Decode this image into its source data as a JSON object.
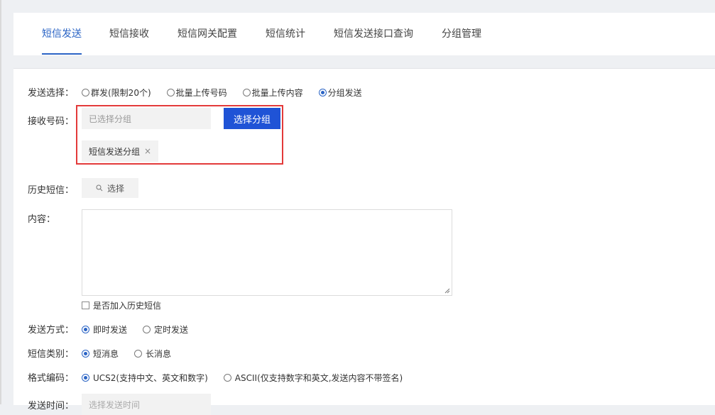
{
  "tabs": [
    {
      "label": "短信发送",
      "active": true
    },
    {
      "label": "短信接收",
      "active": false
    },
    {
      "label": "短信网关配置",
      "active": false
    },
    {
      "label": "短信统计",
      "active": false
    },
    {
      "label": "短信发送接口查询",
      "active": false
    },
    {
      "label": "分组管理",
      "active": false
    }
  ],
  "form": {
    "send_select": {
      "label": "发送选择：",
      "options": [
        "群发(限制20个)",
        "批量上传号码",
        "批量上传内容",
        "分组发送"
      ],
      "selected": "分组发送"
    },
    "receiver": {
      "label": "接收号码：",
      "placeholder": "已选择分组",
      "select_button": "选择分组",
      "tag": "短信发送分组",
      "tag_close": "×"
    },
    "history": {
      "label": "历史短信：",
      "button": "选择"
    },
    "content": {
      "label": "内容：",
      "value": ""
    },
    "add_history": {
      "label": "是否加入历史短信",
      "checked": false
    },
    "send_mode": {
      "label": "发送方式：",
      "options": [
        "即时发送",
        "定时发送"
      ],
      "selected": "即时发送"
    },
    "sms_type": {
      "label": "短信类别：",
      "options": [
        "短消息",
        "长消息"
      ],
      "selected": "短消息"
    },
    "encoding": {
      "label": "格式编码：",
      "options": [
        "UCS2(支持中文、英文和数字)",
        "ASCII(仅支持数字和英文,发送内容不带签名)"
      ],
      "selected": "UCS2(支持中文、英文和数字)"
    },
    "send_time": {
      "label": "发送时间：",
      "placeholder": "选择发送时间"
    }
  },
  "colors": {
    "accent": "#2b64c5",
    "primary_button": "#1f53d6",
    "highlight": "#e33a3a"
  },
  "icons": {
    "history_button": "search-icon",
    "tag_close": "close-icon"
  }
}
